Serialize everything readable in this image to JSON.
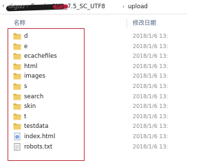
{
  "breadcrumb": {
    "segments": [
      "diguo",
      "EmpireCMS_7.5_SC_UTF8",
      "upload"
    ],
    "separator": "›"
  },
  "columns": {
    "name": "名称",
    "modified": "修改日期"
  },
  "files": [
    {
      "name": "d",
      "date": "2018/1/6 13:",
      "icon": "folder-icon"
    },
    {
      "name": "e",
      "date": "2018/1/6 13:",
      "icon": "folder-icon"
    },
    {
      "name": "ecachefiles",
      "date": "2018/1/6 13:",
      "icon": "folder-icon"
    },
    {
      "name": "html",
      "date": "2018/1/6 13:",
      "icon": "folder-icon"
    },
    {
      "name": "images",
      "date": "2018/1/6 13:",
      "icon": "folder-icon"
    },
    {
      "name": "s",
      "date": "2018/1/6 13:",
      "icon": "folder-icon"
    },
    {
      "name": "search",
      "date": "2018/1/6 13:",
      "icon": "folder-icon"
    },
    {
      "name": "skin",
      "date": "2018/1/6 13:",
      "icon": "folder-icon"
    },
    {
      "name": "t",
      "date": "2018/1/6 13:",
      "icon": "folder-icon"
    },
    {
      "name": "testdata",
      "date": "2018/1/6 13:",
      "icon": "folder-icon"
    },
    {
      "name": "index.html",
      "date": "2018/1/6 13:",
      "icon": "html-file-icon"
    },
    {
      "name": "robots.txt",
      "date": "2018/1/6 13:",
      "icon": "text-file-icon"
    }
  ],
  "colors": {
    "folder": "#e8c25a",
    "highlight_box": "#c0303a",
    "header_text": "#4c607f"
  }
}
